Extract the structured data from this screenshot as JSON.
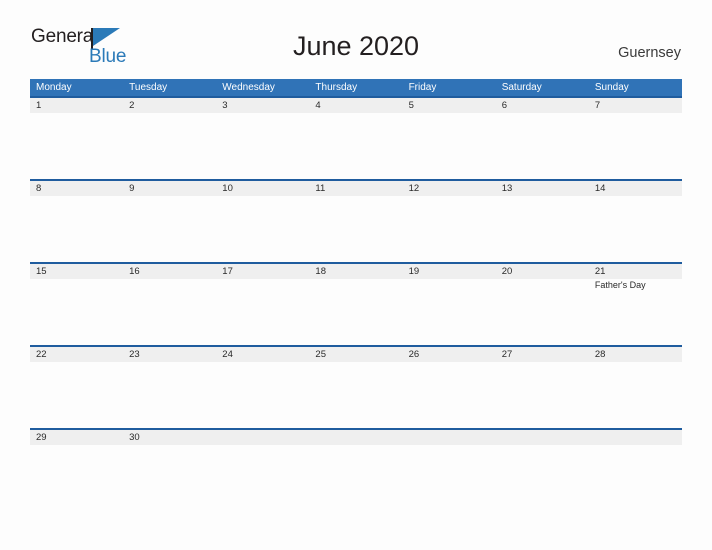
{
  "brand": {
    "name_part1": "General",
    "name_part2": "Blue",
    "icon": "flag-triangle-icon",
    "color_dark": "#231f20",
    "color_blue": "#2b7ab8"
  },
  "header": {
    "title": "June 2020",
    "region": "Guernsey"
  },
  "theme": {
    "header_blue": "#3073b7",
    "separator_blue": "#1f5c9e",
    "band_gray": "#efefef",
    "page_background": "#fdfdfd"
  },
  "calendar": {
    "weekdays": [
      "Monday",
      "Tuesday",
      "Wednesday",
      "Thursday",
      "Friday",
      "Saturday",
      "Sunday"
    ],
    "weeks": [
      {
        "days": [
          {
            "date": "1",
            "event": ""
          },
          {
            "date": "2",
            "event": ""
          },
          {
            "date": "3",
            "event": ""
          },
          {
            "date": "4",
            "event": ""
          },
          {
            "date": "5",
            "event": ""
          },
          {
            "date": "6",
            "event": ""
          },
          {
            "date": "7",
            "event": ""
          }
        ]
      },
      {
        "days": [
          {
            "date": "8",
            "event": ""
          },
          {
            "date": "9",
            "event": ""
          },
          {
            "date": "10",
            "event": ""
          },
          {
            "date": "11",
            "event": ""
          },
          {
            "date": "12",
            "event": ""
          },
          {
            "date": "13",
            "event": ""
          },
          {
            "date": "14",
            "event": ""
          }
        ]
      },
      {
        "days": [
          {
            "date": "15",
            "event": ""
          },
          {
            "date": "16",
            "event": ""
          },
          {
            "date": "17",
            "event": ""
          },
          {
            "date": "18",
            "event": ""
          },
          {
            "date": "19",
            "event": ""
          },
          {
            "date": "20",
            "event": ""
          },
          {
            "date": "21",
            "event": "Father's Day"
          }
        ]
      },
      {
        "days": [
          {
            "date": "22",
            "event": ""
          },
          {
            "date": "23",
            "event": ""
          },
          {
            "date": "24",
            "event": ""
          },
          {
            "date": "25",
            "event": ""
          },
          {
            "date": "26",
            "event": ""
          },
          {
            "date": "27",
            "event": ""
          },
          {
            "date": "28",
            "event": ""
          }
        ]
      },
      {
        "days": [
          {
            "date": "29",
            "event": ""
          },
          {
            "date": "30",
            "event": ""
          },
          {
            "date": "",
            "event": ""
          },
          {
            "date": "",
            "event": ""
          },
          {
            "date": "",
            "event": ""
          },
          {
            "date": "",
            "event": ""
          },
          {
            "date": "",
            "event": ""
          }
        ]
      }
    ]
  }
}
